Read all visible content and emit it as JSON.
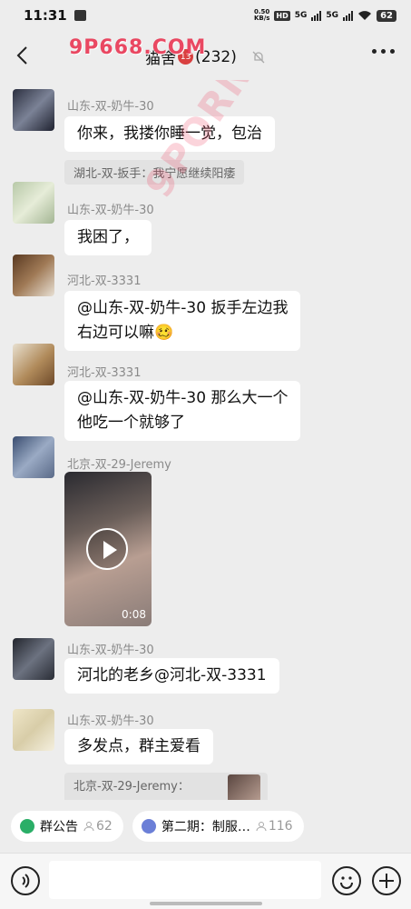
{
  "status_bar": {
    "time": "11:31",
    "speed_value": "0.50",
    "speed_unit": "KB/s",
    "hd": "HD",
    "net1": "5G",
    "net2": "5G",
    "battery": "62"
  },
  "header": {
    "watermark": "9P668.COM",
    "title": "猫舍",
    "title_badge": "13",
    "member_count": "(232)"
  },
  "watermark_diag": "9PORN.COM",
  "messages": [
    {
      "sender": "山东-双-奶牛-30",
      "text": "你来，我搂你睡一觉，包治",
      "quote": "湖北-双-扳手：我宁愿继续阳痿"
    },
    {
      "sender": "山东-双-奶牛-30",
      "text": "我困了，"
    },
    {
      "sender": "河北-双-3331",
      "text_line1": "@山东-双-奶牛-30  扳手左边我",
      "text_line2": "右边可以嘛🥴"
    },
    {
      "sender": "河北-双-3331",
      "text_line1": "@山东-双-奶牛-30  那么大一个",
      "text_line2": "他吃一个就够了"
    },
    {
      "sender": "北京-双-29-Jeremy",
      "video_duration": "0:08"
    },
    {
      "sender": "山东-双-奶牛-30",
      "text": "河北的老乡@河北-双-3331"
    },
    {
      "sender": "山东-双-奶牛-30",
      "text": "多发点，群主爱看",
      "quote": "北京-双-29-Jeremy："
    }
  ],
  "pinned": [
    {
      "label": "群公告",
      "count": "62",
      "color": "#2aae67"
    },
    {
      "label": "第二期：制服…",
      "count": "116",
      "color": "#6b7fd7"
    }
  ],
  "input": {
    "placeholder": ""
  }
}
